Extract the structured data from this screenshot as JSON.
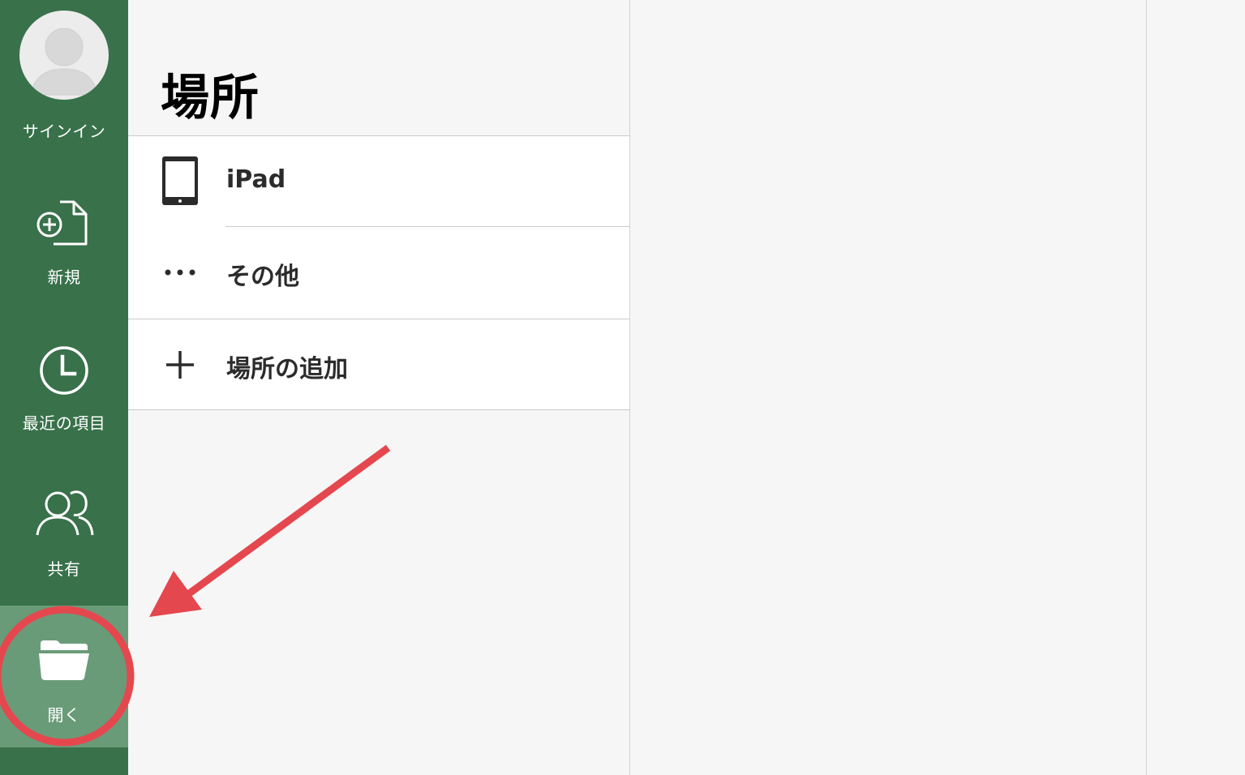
{
  "sidebar": {
    "signin_label": "サインイン",
    "items": [
      {
        "label": "新規",
        "icon": "new-document-icon"
      },
      {
        "label": "最近の項目",
        "icon": "clock-icon"
      },
      {
        "label": "共有",
        "icon": "people-icon"
      },
      {
        "label": "開く",
        "icon": "folder-open-icon",
        "selected": true
      }
    ]
  },
  "panel": {
    "title": "場所",
    "locations": [
      {
        "label": "iPad",
        "icon": "ipad-icon"
      },
      {
        "label": "その他",
        "icon": "more-icon"
      }
    ],
    "add_location": {
      "label": "場所の追加",
      "icon": "plus-icon"
    }
  },
  "colors": {
    "sidebar": "#38714a",
    "sidebar_selected": "#6a9b79",
    "annotation": "#e5474f"
  }
}
